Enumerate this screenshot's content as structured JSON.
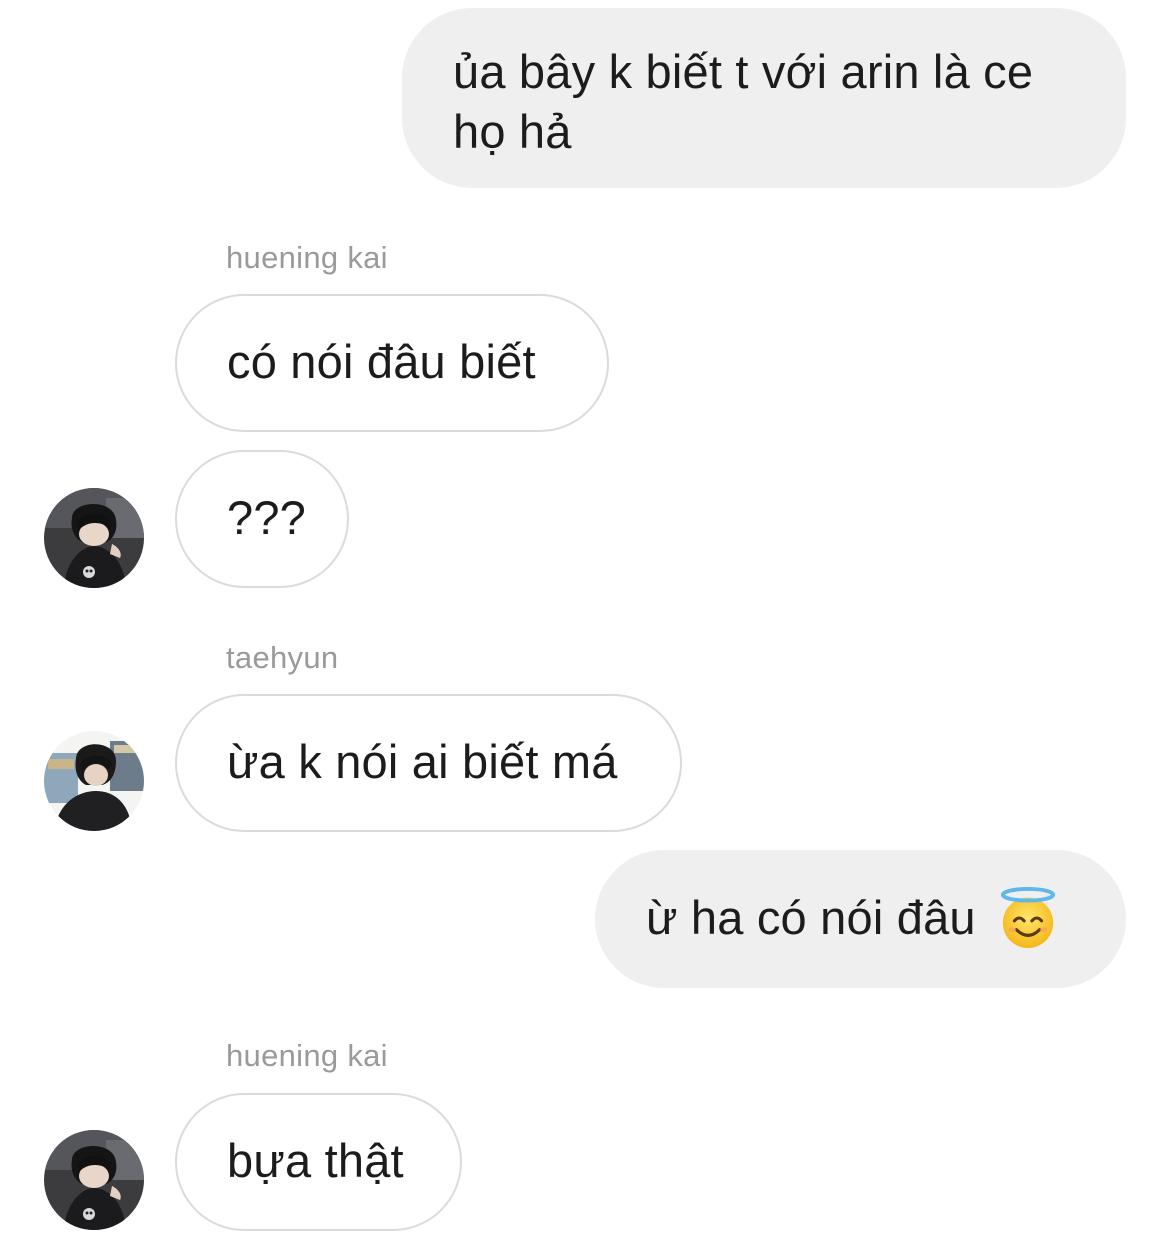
{
  "messages": {
    "m1": {
      "text": "ủa bây k biết t với arin là ce họ hả"
    },
    "m2": {
      "sender": "huening kai",
      "text": "có nói đâu biết"
    },
    "m3": {
      "text": "???"
    },
    "m4": {
      "sender": "taehyun",
      "text": "ừa k nói ai biết má"
    },
    "m5": {
      "text": "ừ ha có nói đâu",
      "emoji": "smiling-face-with-halo-icon"
    },
    "m6": {
      "sender": "huening kai",
      "text": "bựa thật"
    }
  },
  "colors": {
    "outgoing_bubble": "#efefef",
    "incoming_border": "#dbdbdb",
    "sender_name": "#9a9a9a",
    "text": "#1c1c1c"
  }
}
